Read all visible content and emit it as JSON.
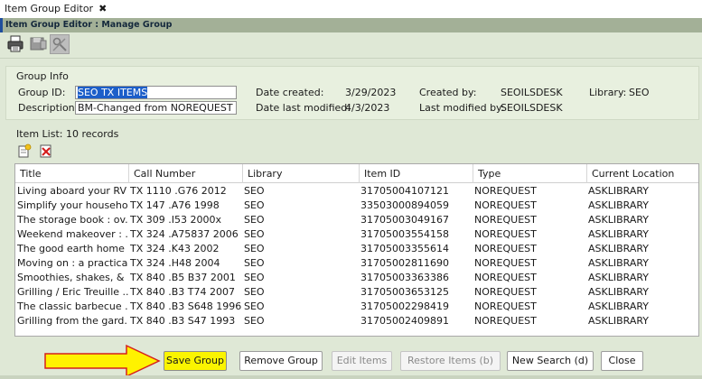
{
  "tab": {
    "title": "Item Group Editor",
    "close": "✖"
  },
  "window_title": "Item Group Editor : Manage Group",
  "toolbar": {
    "print_icon": "printer-icon",
    "save_icon": "disk-icon",
    "tools_icon": "tools-icon"
  },
  "group_info": {
    "legend": "Group Info",
    "group_id_label": "Group ID:",
    "group_id_value": "SEO TX ITEMS",
    "description_label": "Description:",
    "description_value": "BM-Changed from NOREQUEST to ",
    "date_created_label": "Date created:",
    "date_created_value": "3/29/2023",
    "date_modified_label": "Date last modified:",
    "date_modified_value": "4/3/2023",
    "created_by_label": "Created by:",
    "created_by_value": "SEOILSDESK",
    "modified_by_label": "Last modified by:",
    "modified_by_value": "SEOILSDESK",
    "library_label": "Library:",
    "library_value": "SEO"
  },
  "item_list": {
    "label": "Item List: 10 records",
    "add_icon": "add-item-icon",
    "remove_icon": "remove-item-icon",
    "columns": [
      "Title",
      "Call Number",
      "Library",
      "Item ID",
      "Type",
      "Current Location"
    ],
    "rows": [
      [
        "Living aboard your RV",
        "TX 1110 .G76 2012",
        "SEO",
        "31705004107121",
        "NOREQUEST",
        "ASKLIBRARY"
      ],
      [
        "Simplify your household",
        "TX 147 .A76 1998",
        "SEO",
        "33503000894059",
        "NOREQUEST",
        "ASKLIBRARY"
      ],
      [
        "The storage book : ov...",
        "TX 309 .I53 2000x",
        "SEO",
        "31705003049167",
        "NOREQUEST",
        "ASKLIBRARY"
      ],
      [
        "Weekend makeover : ...",
        "TX 324 .A75837 2006",
        "SEO",
        "31705003554158",
        "NOREQUEST",
        "ASKLIBRARY"
      ],
      [
        "The good earth home ...",
        "TX 324 .K43 2002",
        "SEO",
        "31705003355614",
        "NOREQUEST",
        "ASKLIBRARY"
      ],
      [
        "Moving on : a practica...",
        "TX 324 .H48 2004",
        "SEO",
        "31705002811690",
        "NOREQUEST",
        "ASKLIBRARY"
      ],
      [
        "Smoothies, shakes, & ...",
        "TX 840 .B5 B37 2001",
        "SEO",
        "31705003363386",
        "NOREQUEST",
        "ASKLIBRARY"
      ],
      [
        "Grilling / Eric Treuille ...",
        "TX 840 .B3 T74 2007",
        "SEO",
        "31705003653125",
        "NOREQUEST",
        "ASKLIBRARY"
      ],
      [
        "The classic barbecue ...",
        "TX 840 .B3 S648 1996",
        "SEO",
        "31705002298419",
        "NOREQUEST",
        "ASKLIBRARY"
      ],
      [
        "Grilling from the gard...",
        "TX 840 .B3 S47 1993",
        "SEO",
        "31705002409891",
        "NOREQUEST",
        "ASKLIBRARY"
      ]
    ]
  },
  "buttons": {
    "save": "Save Group",
    "remove": "Remove Group",
    "edit": "Edit Items",
    "restore": "Restore Items (b)",
    "new_search": "New Search (d)",
    "close": "Close"
  },
  "colors": {
    "background": "#dfe8d6",
    "title_bar": "#a3b097",
    "selection": "#1c5ec9",
    "highlight": "#fbf400",
    "arrow_fill": "#fff200",
    "arrow_stroke": "#d6201b"
  }
}
